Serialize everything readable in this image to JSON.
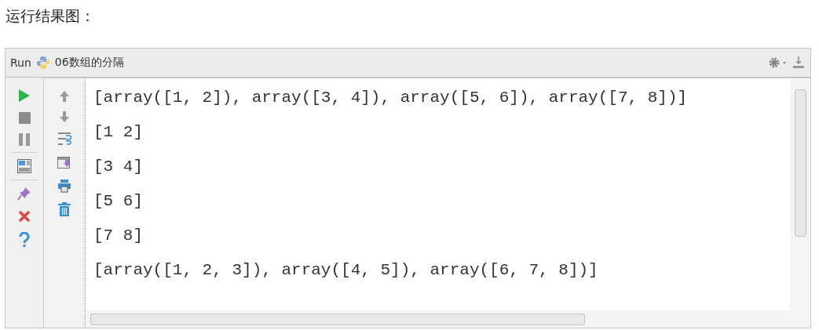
{
  "heading": "运行结果图：",
  "run_panel": {
    "label": "Run",
    "config_name": "06数组的分隔"
  },
  "output_lines": [
    "[array([1, 2]), array([3, 4]), array([5, 6]), array([7, 8])]",
    "[1 2]",
    "[3 4]",
    "[5 6]",
    "[7 8]",
    "[array([1, 2, 3]), array([4, 5]), array([6, 7, 8])]"
  ]
}
